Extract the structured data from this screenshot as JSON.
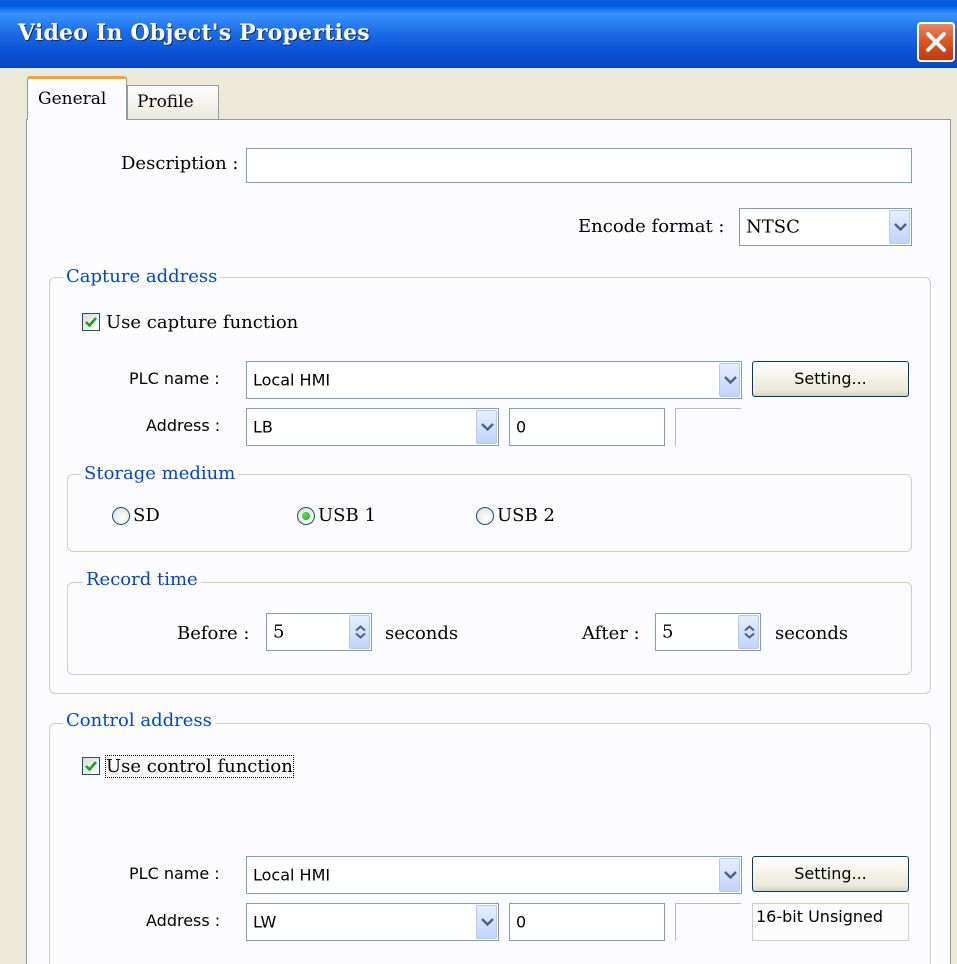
{
  "window": {
    "title": "Video In Object's Properties"
  },
  "tabs": [
    {
      "label": "General",
      "active": true
    },
    {
      "label": "Profile",
      "active": false
    }
  ],
  "general": {
    "description": {
      "label": "Description :",
      "value": ""
    },
    "encode_format": {
      "label": "Encode format :",
      "value": "NTSC"
    }
  },
  "capture": {
    "group_title": "Capture address",
    "use_capture": {
      "label": "Use capture function",
      "checked": true
    },
    "plc_name": {
      "label": "PLC name :",
      "value": "Local HMI"
    },
    "setting_button": "Setting...",
    "address": {
      "label": "Address :",
      "device": "LB",
      "value": "0"
    },
    "storage": {
      "group_title": "Storage medium",
      "options": [
        {
          "label": "SD",
          "selected": false
        },
        {
          "label": "USB 1",
          "selected": true
        },
        {
          "label": "USB 2",
          "selected": false
        }
      ]
    },
    "record_time": {
      "group_title": "Record time",
      "before_label": "Before :",
      "before_value": "5",
      "after_label": "After :",
      "after_value": "5",
      "unit": "seconds"
    }
  },
  "control": {
    "group_title": "Control address",
    "use_control": {
      "label": "Use control function",
      "checked": true
    },
    "plc_name": {
      "label": "PLC name :",
      "value": "Local HMI"
    },
    "setting_button": "Setting...",
    "address": {
      "label": "Address :",
      "device": "LW",
      "value": "0",
      "format": "16-bit Unsigned"
    }
  },
  "colors": {
    "titlebar": "#0058e6",
    "group_title": "#0046d5",
    "tab_highlight": "#f4a531",
    "check_green": "#21a121"
  }
}
